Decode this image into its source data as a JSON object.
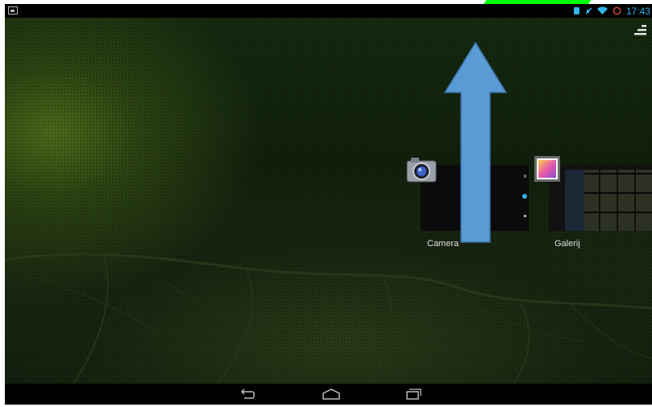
{
  "status_bar": {
    "time": "17:43",
    "icons": [
      "picture-notification-icon",
      "bluetooth-icon",
      "no-sound-icon",
      "wifi-icon",
      "alarm-icon"
    ],
    "accent_color": "#33b5e5"
  },
  "recent_apps": [
    {
      "label": "Camera",
      "icon": "camera-icon"
    },
    {
      "label": "Galerij",
      "icon": "gallery-icon"
    }
  ],
  "overlay": {
    "arrow_direction": "up",
    "arrow_color": "#5b9bd5"
  },
  "nav_bar": {
    "buttons": [
      "back-button",
      "home-button",
      "recent-apps-button"
    ]
  }
}
